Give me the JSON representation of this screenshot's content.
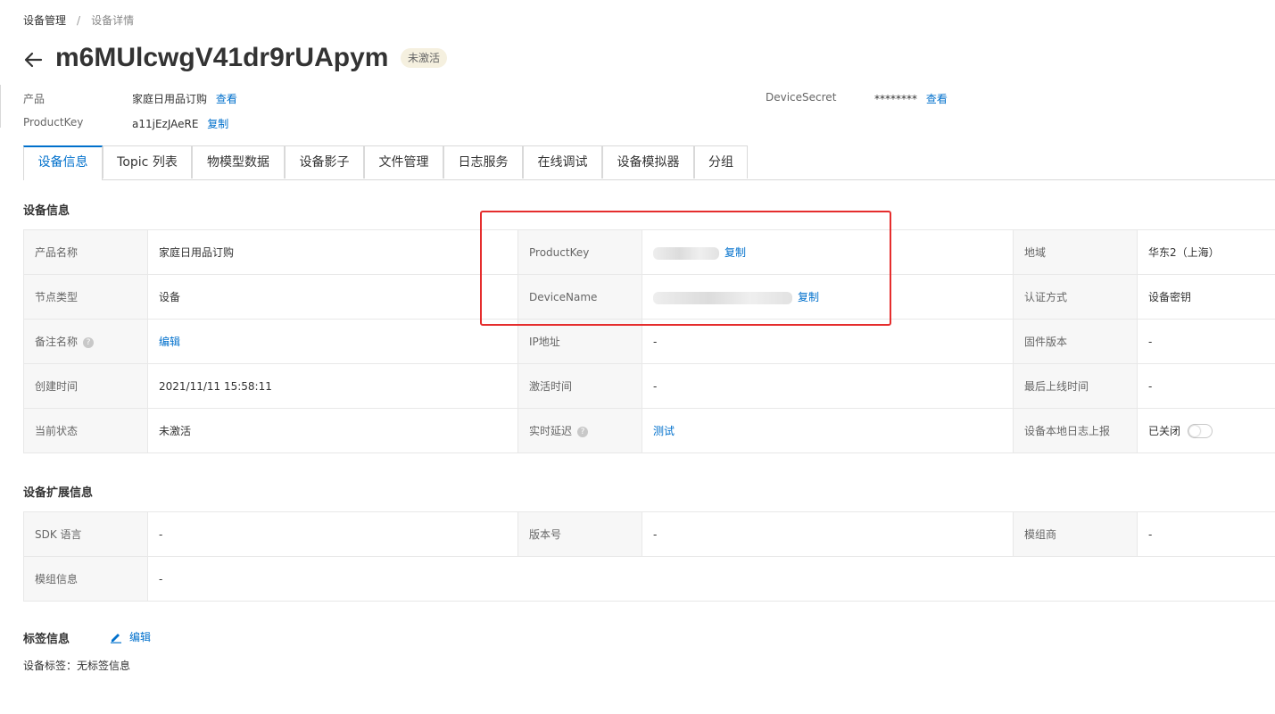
{
  "breadcrumb": {
    "items": [
      "设备管理",
      "设备详情"
    ],
    "separator": "/"
  },
  "header": {
    "title": "m6MUlcwgV41dr9rUApym",
    "status": "未激活"
  },
  "meta": {
    "product_label": "产品",
    "product_value": "家庭日用品订购",
    "product_link": "查看",
    "productkey_label": "ProductKey",
    "productkey_value": "a11jEzJAeRE",
    "productkey_link": "复制",
    "devicesecret_label": "DeviceSecret",
    "devicesecret_value": "********",
    "devicesecret_link": "查看"
  },
  "tabs": [
    {
      "label": "设备信息",
      "active": true
    },
    {
      "label": "Topic 列表",
      "active": false
    },
    {
      "label": "物模型数据",
      "active": false
    },
    {
      "label": "设备影子",
      "active": false
    },
    {
      "label": "文件管理",
      "active": false
    },
    {
      "label": "日志服务",
      "active": false
    },
    {
      "label": "在线调试",
      "active": false
    },
    {
      "label": "设备模拟器",
      "active": false
    },
    {
      "label": "分组",
      "active": false
    }
  ],
  "device_info": {
    "title": "设备信息",
    "product_name_label": "产品名称",
    "product_name_value": "家庭日用品订购",
    "productkey_label": "ProductKey",
    "productkey_copy": "复制",
    "region_label": "地域",
    "region_value": "华东2（上海）",
    "node_type_label": "节点类型",
    "node_type_value": "设备",
    "devicename_label": "DeviceName",
    "devicename_copy": "复制",
    "auth_label": "认证方式",
    "auth_value": "设备密钥",
    "alias_label": "备注名称",
    "alias_edit": "编辑",
    "ip_label": "IP地址",
    "ip_value": "-",
    "firmware_label": "固件版本",
    "firmware_value": "-",
    "created_label": "创建时间",
    "created_value": "2021/11/11 15:58:11",
    "activated_label": "激活时间",
    "activated_value": "-",
    "last_online_label": "最后上线时间",
    "last_online_value": "-",
    "state_label": "当前状态",
    "state_value": "未激活",
    "latency_label": "实时延迟",
    "latency_test": "测试",
    "local_log_label": "设备本地日志上报",
    "local_log_value": "已关闭",
    "local_log_on": false
  },
  "ext_info": {
    "title": "设备扩展信息",
    "sdk_label": "SDK 语言",
    "sdk_value": "-",
    "version_label": "版本号",
    "version_value": "-",
    "vendor_label": "模组商",
    "vendor_value": "-",
    "module_label": "模组信息",
    "module_value": "-"
  },
  "tags": {
    "title": "标签信息",
    "edit": "编辑",
    "line_label": "设备标签：",
    "line_value": "无标签信息"
  },
  "colors": {
    "link": "#0070cc",
    "highlight_box": "#e52d2d",
    "status_pill_bg": "#f5f0df"
  },
  "icons": {
    "back": "arrow-left-icon",
    "help": "question-circle-icon",
    "edit": "pencil-icon"
  }
}
